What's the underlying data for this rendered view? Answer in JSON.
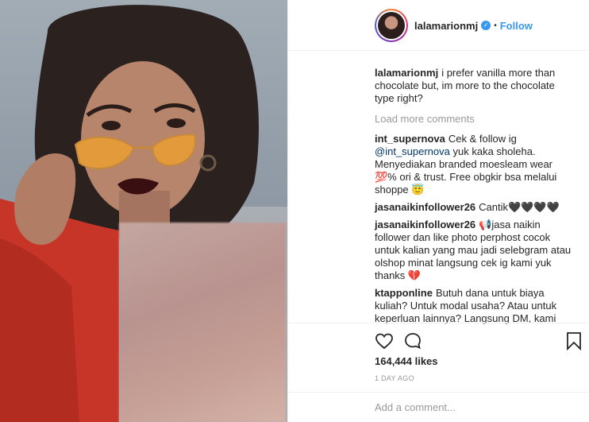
{
  "post": {
    "username": "lalamarionmj",
    "verified": true,
    "follow_label": "Follow",
    "separator": "•",
    "caption": "i prefer vanilla more than chocolate but, im more to the chocolate type right?"
  },
  "load_more_label": "Load more comments",
  "comments": [
    {
      "user": "int_supernova",
      "pre": "Cek & follow ig",
      "mention": "@int_supernova",
      "post": "yuk kaka sholeha. Menyediakan branded moesleam wear 💯% ori & trust. Free obgkir bsa melalui shoppe 😇"
    },
    {
      "user": "jasanaikinfollower26",
      "text": "Cantik🖤🖤🖤🖤"
    },
    {
      "user": "jasanaikinfollower26",
      "text": "📢jasa naikin follower dan like photo perphost cocok untuk kalian yang mau jadi selebgram atau olshop minat langsung cek ig kami yuk thanks 💔"
    },
    {
      "user": "ktapponline",
      "text": "Butuh dana untuk biaya kuliah? Untuk modal usaha? Atau untuk keperluan lainnya? Langsung DM, kami siap membantu👼"
    }
  ],
  "actions": {
    "like_icon": "heart-icon",
    "comment_icon": "comment-bubble-icon",
    "save_icon": "bookmark-icon"
  },
  "likes": "164,444 likes",
  "timestamp": "1 DAY AGO",
  "add_comment_placeholder": "Add a comment...",
  "colors": {
    "accent": "#3897f0",
    "text": "#262626",
    "muted": "#999999",
    "border": "#efefef"
  }
}
